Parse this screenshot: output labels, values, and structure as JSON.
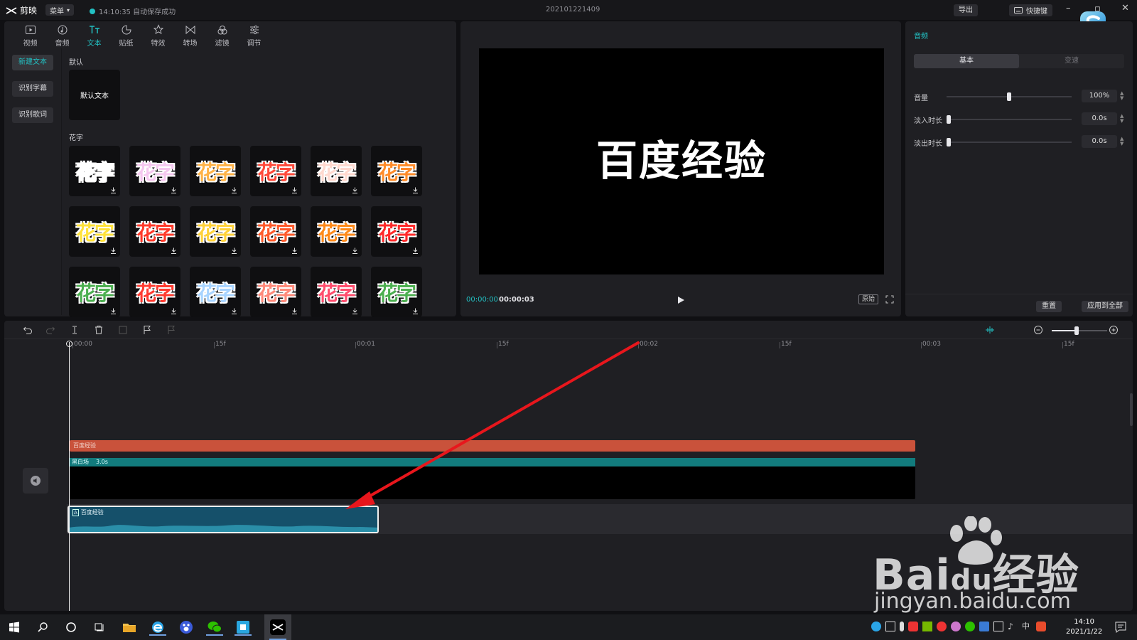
{
  "titlebar": {
    "app_name": "剪映",
    "menu_label": "菜单",
    "autosave_status": "14:10:35 自动保存成功",
    "project_name": "202101221409",
    "export_label": "导出",
    "shortcut_label": "快捷键"
  },
  "media_tabs": [
    {
      "label": "视频",
      "icon": "video-icon"
    },
    {
      "label": "音频",
      "icon": "audio-icon"
    },
    {
      "label": "文本",
      "icon": "text-icon",
      "active": true
    },
    {
      "label": "贴纸",
      "icon": "sticker-icon"
    },
    {
      "label": "特效",
      "icon": "effects-icon"
    },
    {
      "label": "转场",
      "icon": "transition-icon"
    },
    {
      "label": "滤镜",
      "icon": "filter-icon"
    },
    {
      "label": "调节",
      "icon": "adjust-icon"
    }
  ],
  "text_sidebar": {
    "new_text": "新建文本",
    "recognize_subtitles": "识别字幕",
    "recognize_lyrics": "识别歌词"
  },
  "text_library": {
    "default_section": "默认",
    "default_card": "默认文本",
    "fancy_section": "花字",
    "fancy_label": "花字",
    "fancy_colors": [
      "#ffffff",
      "#f5c8f0",
      "#ffb347",
      "#ff4a3a",
      "#ffd9cf",
      "#ff8c2a",
      "#ffe23a",
      "#ff3a2a",
      "#ffd23a",
      "#ff5a2a",
      "#ff8a1a",
      "#ff2a2a",
      "#4caf50",
      "#ff3b30",
      "#a8d4ff",
      "#ff8a7a",
      "#ff4d6d",
      "#4caf50"
    ]
  },
  "player": {
    "preview_text": "百度经验",
    "current_time": "00:00:00",
    "total_time": "00:00:03",
    "ratio_label": "原始"
  },
  "properties": {
    "title": "音频",
    "tab_basic": "基本",
    "tab_speed": "变速",
    "volume_label": "音量",
    "volume_value": "100%",
    "volume_level": 0.5,
    "fade_in_label": "淡入时长",
    "fade_in_value": "0.0s",
    "fade_out_label": "淡出时长",
    "fade_out_value": "0.0s",
    "reset_label": "重置",
    "apply_all_label": "应用到全部"
  },
  "timeline": {
    "ruler": [
      "00:00",
      "15f",
      "00:01",
      "15f",
      "00:02",
      "15f",
      "00:03",
      "15f"
    ],
    "text_clip": "百度经验",
    "video_clip_name": "黑白场",
    "video_clip_duration": "3.0s",
    "audio_clip": "百度经验",
    "zoom_level": 0.45
  },
  "watermark": {
    "brand": "Bai",
    "brand2": "du",
    "brand3": "经验",
    "url": "jingyan.baidu.com"
  },
  "taskbar": {
    "clock_time": "14:10",
    "clock_date": "2021/1/22"
  },
  "colors": {
    "accent": "#22c1c3",
    "text_clip": "#c9523b",
    "video_clip_header": "#127b7d",
    "audio_clip": "#15506a",
    "annotation_arrow": "#e8161c"
  }
}
